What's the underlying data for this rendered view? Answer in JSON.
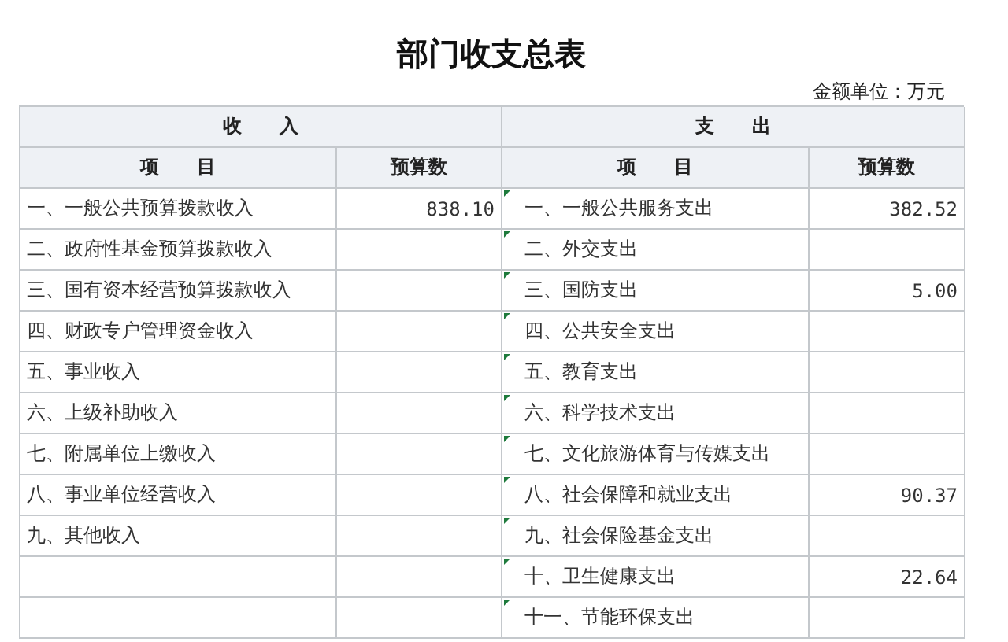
{
  "title": "部门收支总表",
  "unit": "金额单位：万元",
  "group_headers": [
    "收　　入",
    "支　　出"
  ],
  "column_headers": [
    "项　　目",
    "预算数",
    "项　　目",
    "预算数"
  ],
  "income": [
    {
      "item": "一、一般公共预算拨款收入",
      "amount": "838.10"
    },
    {
      "item": "二、政府性基金预算拨款收入"
    },
    {
      "item": "三、国有资本经营预算拨款收入"
    },
    {
      "item": "四、财政专户管理资金收入"
    },
    {
      "item": "五、事业收入"
    },
    {
      "item": "六、上级补助收入"
    },
    {
      "item": "七、附属单位上缴收入"
    },
    {
      "item": "八、事业单位经营收入"
    },
    {
      "item": "九、其他收入"
    }
  ],
  "expense": [
    {
      "item": "一、一般公共服务支出",
      "amount": "382.52"
    },
    {
      "item": "二、外交支出"
    },
    {
      "item": "三、国防支出",
      "amount": "5.00"
    },
    {
      "item": "四、公共安全支出"
    },
    {
      "item": "五、教育支出"
    },
    {
      "item": "六、科学技术支出"
    },
    {
      "item": "七、文化旅游体育与传媒支出"
    },
    {
      "item": "八、社会保障和就业支出",
      "amount": "90.37"
    },
    {
      "item": "九、社会保险基金支出"
    },
    {
      "item": "十、卫生健康支出",
      "amount": "22.64"
    },
    {
      "item": "十一、节能环保支出"
    }
  ]
}
